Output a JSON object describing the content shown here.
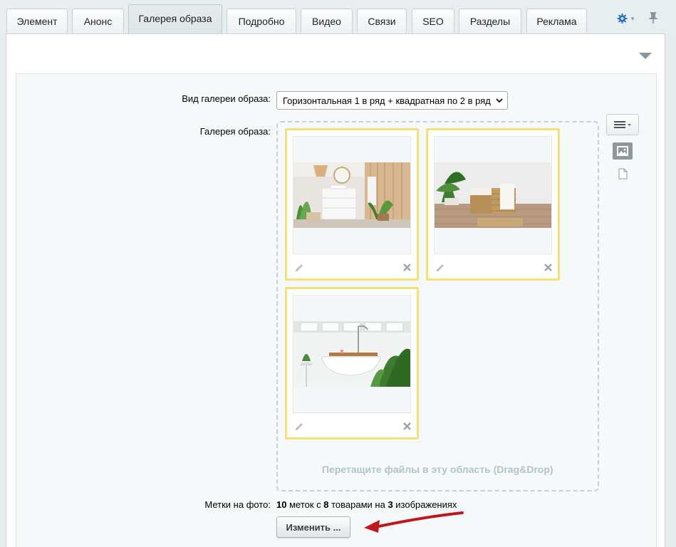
{
  "tabs": [
    {
      "label": "Элемент"
    },
    {
      "label": "Анонс"
    },
    {
      "label": "Галерея образа",
      "active": true
    },
    {
      "label": "Подробно"
    },
    {
      "label": "Видео"
    },
    {
      "label": "Связи"
    },
    {
      "label": "SEO"
    },
    {
      "label": "Разделы"
    },
    {
      "label": "Реклама"
    }
  ],
  "toolbar": {
    "settings_icon": "gear-icon",
    "pin_icon": "pin-icon",
    "accent_color": "#2a72c4"
  },
  "form": {
    "gallery_type_label": "Вид галереи образа:",
    "gallery_type_value": "Горизонтальная 1 в ряд + квадратная по 2 в ряд",
    "gallery_label": "Галерея образа:",
    "drop_hint": "Перетащите файлы в эту область (Drag&Drop)",
    "marks_label": "Метки на фото:",
    "marks": {
      "count": "10",
      "text1": " меток с ",
      "products": "8",
      "text2": " товарами на ",
      "images": "3",
      "text3": " изображениях"
    },
    "change_button": "Изменить ..."
  },
  "gallery": [
    {
      "image": "bathroom-interior-photo"
    },
    {
      "image": "baskets-plant-photo"
    },
    {
      "image": "bathtub-plants-photo"
    }
  ],
  "colors": {
    "card_border": "#f2e07a",
    "drop_hint": "#b4c2c9",
    "annotation_arrow": "#c0171f"
  }
}
